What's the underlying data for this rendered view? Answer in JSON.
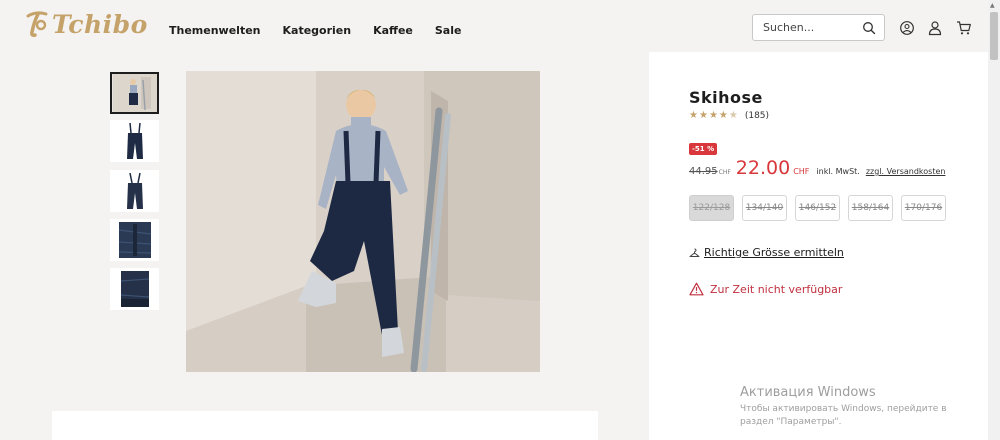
{
  "header": {
    "logo_text": "Tchibo",
    "nav": [
      "Themenwelten",
      "Kategorien",
      "Kaffee",
      "Sale"
    ],
    "search_placeholder": "Suchen...",
    "icons": [
      "search-icon",
      "service-icon",
      "account-icon",
      "cart-icon"
    ]
  },
  "gallery": {
    "thumbnail_count": 5,
    "active_thumbnail": 1
  },
  "product": {
    "title": "Skihose",
    "rating_stars": 4.5,
    "rating_count": "(185)",
    "discount_badge": "-51 %",
    "old_price": "44.95",
    "old_currency": "CHF",
    "price": "22.00",
    "currency": "CHF",
    "vat_text": "inkl. MwSt.",
    "shipping_link": "zzgl. Versandkosten",
    "sizes": [
      "122/128",
      "134/140",
      "146/152",
      "158/164",
      "170/176"
    ],
    "selected_size": "122/128",
    "size_finder": "Richtige Grösse ermitteln",
    "availability": "Zur Zeit nicht verfügbar"
  },
  "watermark": {
    "title": "Активация Windows",
    "subtitle": "Чтобы активировать Windows, перейдите в раздел \"Параметры\"."
  },
  "colors": {
    "brand_gold": "#c5a26a",
    "sale_red": "#d8383b",
    "background": "#f4f3f1"
  }
}
